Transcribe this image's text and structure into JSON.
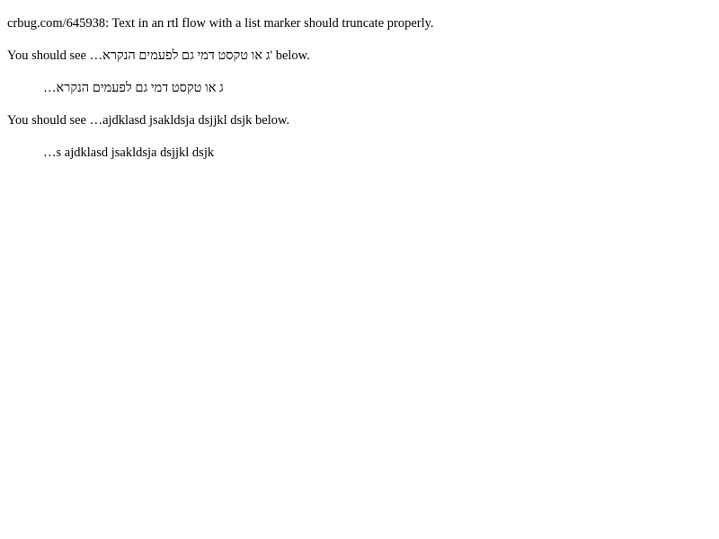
{
  "intro": "crbug.com/645938: Text in an rtl flow with a list marker should truncate properly.",
  "tests": [
    {
      "instruction": "You should see …ג או טקסט דמי גם לפעמים הנקרא' below.",
      "truncated_item": "…ג או טקסט דמי גם לפעמים הנקרא"
    },
    {
      "instruction": "You should see …ajdklasd jsakldsja dsjjkl dsjk below.",
      "truncated_item": "…s ajdklasd jsakldsja dsjjkl dsjk"
    }
  ]
}
